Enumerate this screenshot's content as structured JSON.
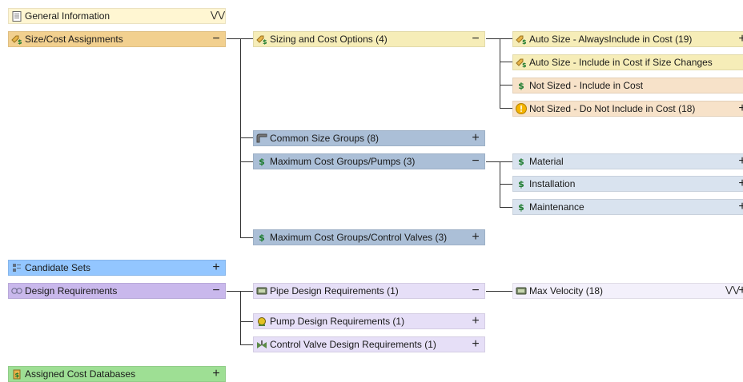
{
  "colors": {
    "general": "#fff6d2",
    "sizecost": "#f2d08f",
    "sizing": "#f6edb8",
    "common": "#abbfd7",
    "maxcost": "#abbfd7",
    "blueLight": "#d9e3ef",
    "candidate": "#93c6ff",
    "design": "#c9b8ec",
    "designChild": "#e6dff7",
    "assigned": "#9edf94",
    "notSized": "#f7e2c9"
  },
  "tree": {
    "general_information": "General Information",
    "size_cost_assignments": "Size/Cost Assignments",
    "sizing_and_cost_options": "Sizing and Cost Options (4)",
    "auto_size_always": "Auto Size - AlwaysInclude in Cost (19)",
    "auto_size_if_changes": "Auto Size - Include in Cost if Size Changes",
    "not_sized_include": "Not Sized - Include in Cost",
    "not_sized_exclude": "Not Sized - Do Not Include in Cost (18)",
    "common_size_groups": "Common Size Groups (8)",
    "max_cost_pumps": "Maximum Cost Groups/Pumps (3)",
    "material": "Material",
    "installation": "Installation",
    "maintenance": "Maintenance",
    "max_cost_valves": "Maximum Cost Groups/Control Valves (3)",
    "candidate_sets": "Candidate Sets",
    "design_requirements": "Design Requirements",
    "pipe_design": "Pipe Design Requirements (1)",
    "max_velocity": "Max Velocity (18)",
    "pump_design": "Pump Design Requirements (1)",
    "valve_design": "Control Valve Design Requirements (1)",
    "assigned_cost_db": "Assigned Cost Databases"
  },
  "controls": {
    "expand": "+",
    "collapse": "−",
    "double_chevron": "»",
    "more": "»"
  },
  "icons": {
    "general": "document-icon",
    "sizecost": "size-cost-icon",
    "dollar": "dollar-icon",
    "warning": "warning-icon",
    "common": "size-group-icon",
    "candidate": "candidate-icon",
    "design": "design-icon",
    "pipe": "pipe-icon",
    "pump": "pump-icon",
    "valve": "valve-icon",
    "database": "database-icon"
  }
}
